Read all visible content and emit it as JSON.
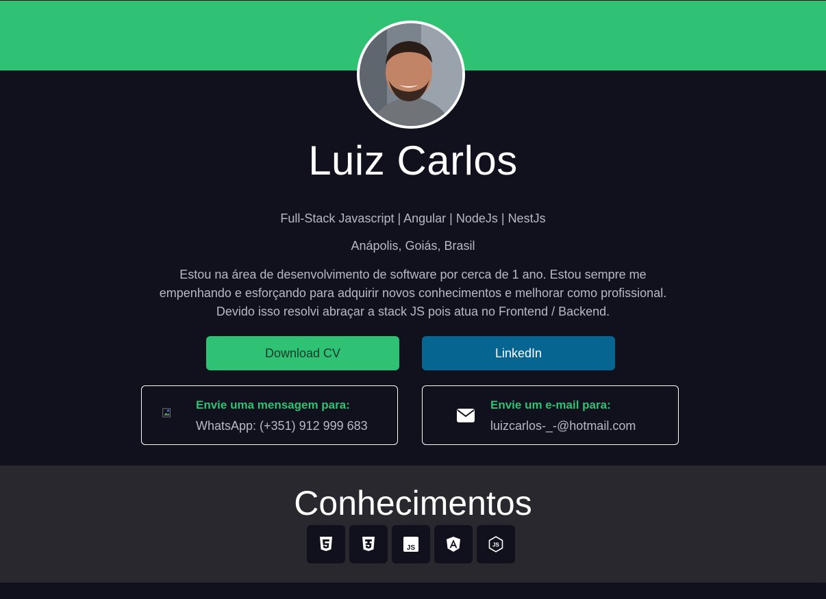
{
  "profile": {
    "name": "Luiz Carlos",
    "subtitle": "Full-Stack Javascript | Angular | NodeJs | NestJs",
    "location": "Anápolis, Goiás, Brasil",
    "bio": "Estou na área de desenvolvimento de software por cerca de 1 ano. Estou sempre me empenhando e esforçando para adquirir novos conhecimentos e melhorar como profissional. Devido isso resolvi abraçar a stack JS pois atua no Frontend / Backend."
  },
  "buttons": {
    "download_cv": "Download CV",
    "linkedin": "LinkedIn"
  },
  "contacts": {
    "whatsapp": {
      "title": "Envie uma mensagem para:",
      "value": "WhatsApp: (+351) 912 999 683",
      "icon": "whatsapp-icon"
    },
    "email": {
      "title": "Envie um e-mail para:",
      "value": "luizcarlos-_-@hotmail.com",
      "icon": "envelope-icon"
    }
  },
  "skills": {
    "title": "Conhecimentos",
    "items": [
      {
        "icon": "html5-icon"
      },
      {
        "icon": "css3-icon"
      },
      {
        "icon": "javascript-icon"
      },
      {
        "icon": "angular-icon"
      },
      {
        "icon": "nodejs-icon"
      }
    ]
  },
  "colors": {
    "accent": "#2fc174",
    "linkedin": "#066691",
    "background": "#10111c",
    "section": "#29282e"
  }
}
